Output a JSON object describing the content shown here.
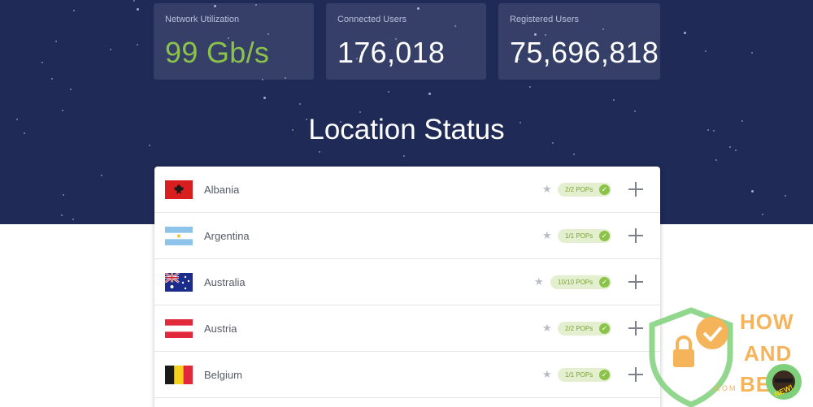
{
  "stats": [
    {
      "label": "Network Utilization",
      "value": "99 Gb/s"
    },
    {
      "label": "Connected Users",
      "value": "176,018"
    },
    {
      "label": "Registered Users",
      "value": "75,696,818"
    }
  ],
  "section_title": "Location Status",
  "locations": [
    {
      "country": "Albania",
      "pops": "2/2 POPs"
    },
    {
      "country": "Argentina",
      "pops": "1/1 POPs"
    },
    {
      "country": "Australia",
      "pops": "10/10 POPs"
    },
    {
      "country": "Austria",
      "pops": "2/2 POPs"
    },
    {
      "country": "Belgium",
      "pops": "1/1 POPs"
    }
  ],
  "watermark": {
    "line1": "HOW",
    "line2": "AND",
    "line3": "BE",
    "domain": ".COM",
    "badge": "NEW!"
  },
  "colors": {
    "hero_bg": "#1f2a57",
    "accent_green": "#8bc34a",
    "pops_bg": "#e3efcf"
  }
}
